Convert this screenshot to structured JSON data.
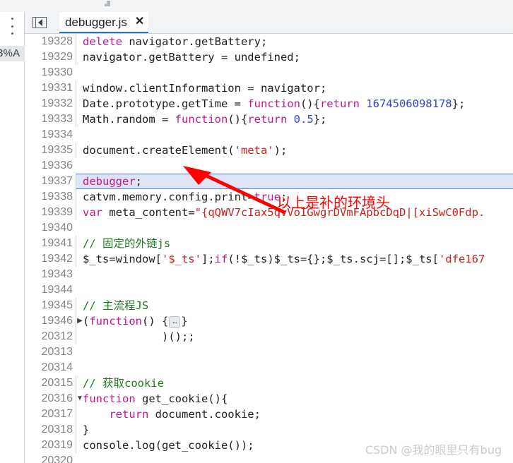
{
  "colors": {
    "keyword": "#c5168c",
    "number": "#3344cc",
    "string": "#c5221f",
    "comment": "#217a21",
    "tab_underline": "#1a73e8",
    "highlight_bg": "#dfe5f7",
    "annotation_red": "#ff0000"
  },
  "rail": {
    "menu_icon": "kebab-menu-icon",
    "clipped_label": "3%A"
  },
  "tabbar": {
    "navigator_toggle_icon": "show-navigator-icon",
    "tab_title": "debugger.js",
    "close_label": "✕"
  },
  "annotation": {
    "text": "以上是补的环境头",
    "arrow_icon": "red-arrow-icon"
  },
  "watermark": {
    "text": "CSDN @我的眼里只有bug"
  },
  "editor": {
    "highlighted_line": "19337",
    "lines": [
      {
        "n": "19328",
        "fold": "",
        "highlight": false,
        "tokens": [
          {
            "t": "delete",
            "c": "kw"
          },
          {
            "t": " navigator.getBattery;",
            "c": ""
          }
        ]
      },
      {
        "n": "19329",
        "fold": "",
        "highlight": false,
        "tokens": [
          {
            "t": "navigator.getBattery = undefined;",
            "c": ""
          }
        ]
      },
      {
        "n": "19330",
        "fold": "",
        "highlight": false,
        "tokens": []
      },
      {
        "n": "19331",
        "fold": "",
        "highlight": false,
        "tokens": [
          {
            "t": "window.clientInformation = navigator;",
            "c": ""
          }
        ]
      },
      {
        "n": "19332",
        "fold": "",
        "highlight": false,
        "tokens": [
          {
            "t": "Date.prototype.getTime = ",
            "c": ""
          },
          {
            "t": "function",
            "c": "kw"
          },
          {
            "t": "(){",
            "c": ""
          },
          {
            "t": "return",
            "c": "kw"
          },
          {
            "t": " ",
            "c": ""
          },
          {
            "t": "1674506098178",
            "c": "num"
          },
          {
            "t": "};",
            "c": ""
          }
        ]
      },
      {
        "n": "19333",
        "fold": "",
        "highlight": false,
        "tokens": [
          {
            "t": "Math.random = ",
            "c": ""
          },
          {
            "t": "function",
            "c": "kw"
          },
          {
            "t": "(){",
            "c": ""
          },
          {
            "t": "return",
            "c": "kw"
          },
          {
            "t": " ",
            "c": ""
          },
          {
            "t": "0.5",
            "c": "num"
          },
          {
            "t": "};",
            "c": ""
          }
        ]
      },
      {
        "n": "19334",
        "fold": "",
        "highlight": false,
        "tokens": []
      },
      {
        "n": "19335",
        "fold": "",
        "highlight": false,
        "tokens": [
          {
            "t": "document.createElement(",
            "c": ""
          },
          {
            "t": "'meta'",
            "c": "str"
          },
          {
            "t": ");",
            "c": ""
          }
        ]
      },
      {
        "n": "19336",
        "fold": "",
        "highlight": false,
        "tokens": []
      },
      {
        "n": "19337",
        "fold": "",
        "highlight": true,
        "tokens": [
          {
            "t": "debugger",
            "c": "kw"
          },
          {
            "t": ";",
            "c": ""
          }
        ]
      },
      {
        "n": "19338",
        "fold": "",
        "highlight": false,
        "tokens": [
          {
            "t": "catvm.memory.config.print=",
            "c": ""
          },
          {
            "t": "true",
            "c": "bool"
          },
          {
            "t": ";",
            "c": ""
          }
        ]
      },
      {
        "n": "19339",
        "fold": "",
        "highlight": false,
        "tokens": [
          {
            "t": "var",
            "c": "kw"
          },
          {
            "t": " meta_content=",
            "c": ""
          },
          {
            "t": "\"{qQWV7cIax5qvVoIGwgrDVmFApbcDqD|[xiSwC0Fdp.",
            "c": "str"
          }
        ]
      },
      {
        "n": "19340",
        "fold": "",
        "highlight": false,
        "tokens": []
      },
      {
        "n": "19341",
        "fold": "",
        "highlight": false,
        "tokens": [
          {
            "t": "// 固定的外链js",
            "c": "cmt"
          }
        ]
      },
      {
        "n": "19342",
        "fold": "",
        "highlight": false,
        "tokens": [
          {
            "t": "$_ts=window[",
            "c": ""
          },
          {
            "t": "'$_ts'",
            "c": "str"
          },
          {
            "t": "];",
            "c": ""
          },
          {
            "t": "if",
            "c": "kw"
          },
          {
            "t": "(!$_ts)$_ts={};$_ts.scj=[];$_ts[",
            "c": ""
          },
          {
            "t": "'dfe167",
            "c": "str"
          }
        ]
      },
      {
        "n": "19343",
        "fold": "",
        "highlight": false,
        "tokens": []
      },
      {
        "n": "19344",
        "fold": "",
        "highlight": false,
        "tokens": []
      },
      {
        "n": "19345",
        "fold": "",
        "highlight": false,
        "tokens": [
          {
            "t": "// 主流程JS",
            "c": "cmt"
          }
        ]
      },
      {
        "n": "19346",
        "fold": "▶",
        "highlight": false,
        "tokens": [
          {
            "t": "(",
            "c": ""
          },
          {
            "t": "function",
            "c": "kw"
          },
          {
            "t": "() {",
            "c": ""
          },
          {
            "t": "…",
            "c": "foldbox"
          },
          {
            "t": "}",
            "c": ""
          }
        ]
      },
      {
        "n": "20312",
        "fold": "",
        "highlight": false,
        "tokens": [
          {
            "t": "            )();;",
            "c": ""
          }
        ]
      },
      {
        "n": "20313",
        "fold": "",
        "highlight": false,
        "tokens": []
      },
      {
        "n": "20314",
        "fold": "",
        "highlight": false,
        "tokens": []
      },
      {
        "n": "20315",
        "fold": "",
        "highlight": false,
        "tokens": [
          {
            "t": "// 获取cookie",
            "c": "cmt"
          }
        ]
      },
      {
        "n": "20316",
        "fold": "▼",
        "highlight": false,
        "tokens": [
          {
            "t": "function",
            "c": "kw"
          },
          {
            "t": " get_cookie(){",
            "c": ""
          }
        ]
      },
      {
        "n": "20317",
        "fold": "",
        "highlight": false,
        "tokens": [
          {
            "t": "    ",
            "c": ""
          },
          {
            "t": "return",
            "c": "kw"
          },
          {
            "t": " document.cookie;",
            "c": ""
          }
        ]
      },
      {
        "n": "20318",
        "fold": "",
        "highlight": false,
        "tokens": [
          {
            "t": "}",
            "c": ""
          }
        ]
      },
      {
        "n": "20319",
        "fold": "",
        "highlight": false,
        "tokens": [
          {
            "t": "console.log(get_cookie());",
            "c": ""
          }
        ]
      },
      {
        "n": "20320",
        "fold": "",
        "highlight": false,
        "tokens": []
      }
    ]
  }
}
